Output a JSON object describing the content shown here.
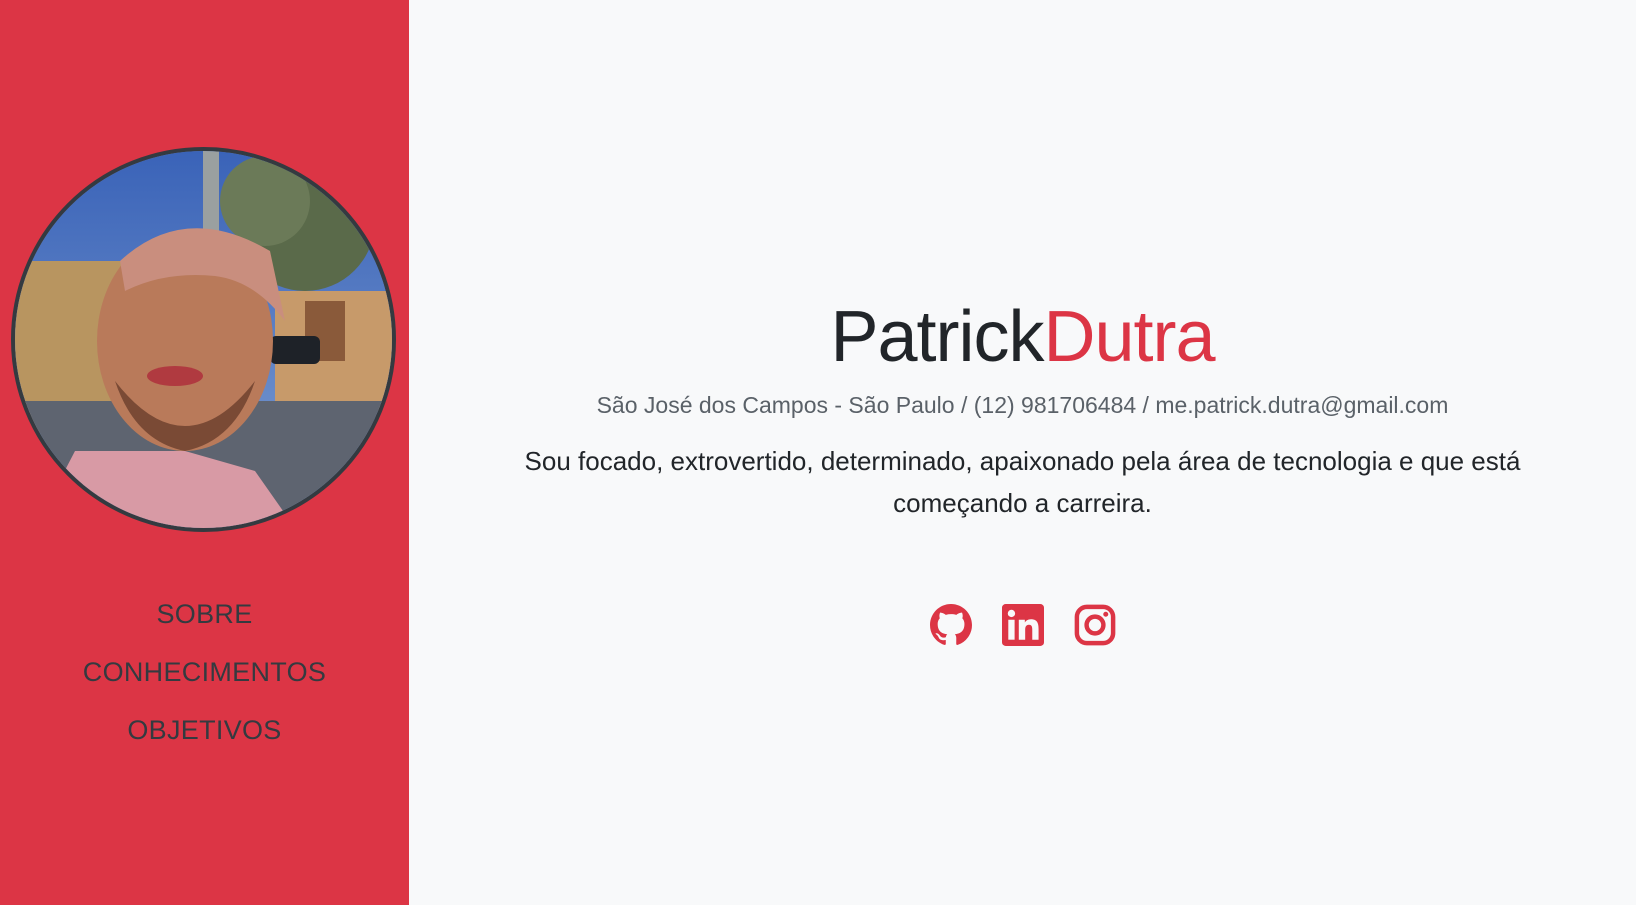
{
  "colors": {
    "accent": "#dc3545",
    "sidebar_bg": "#dc3545",
    "page_bg": "#f8f9fa",
    "text_dark": "#212529",
    "nav_text": "#343a40",
    "muted": "#5a6168"
  },
  "sidebar": {
    "nav": [
      {
        "label": "SOBRE"
      },
      {
        "label": "CONHECIMENTOS"
      },
      {
        "label": "OBJETIVOS"
      }
    ]
  },
  "header": {
    "first_name": "Patrick",
    "last_name": "Dutra",
    "contact": "São José dos Campos - São Paulo / (12) 981706484 / me.patrick.dutra@gmail.com"
  },
  "bio": {
    "text": "Sou focado, extrovertido, determinado, apaixonado pela área de tecnologia e que está começando a carreira."
  },
  "social": [
    {
      "icon": "github-icon"
    },
    {
      "icon": "linkedin-icon"
    },
    {
      "icon": "instagram-icon"
    }
  ]
}
